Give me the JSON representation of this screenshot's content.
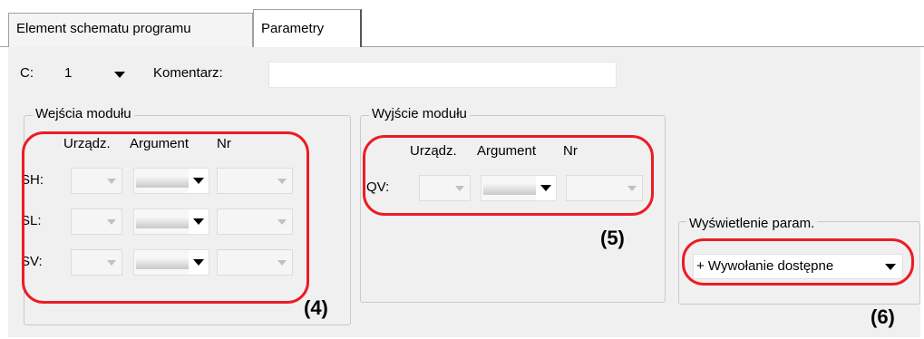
{
  "tabs": [
    {
      "label": "Element schematu programu",
      "active": false
    },
    {
      "label": "Parametry",
      "active": true
    }
  ],
  "top": {
    "c_label": "C:",
    "c_value": "1",
    "comment_label": "Komentarz:",
    "comment_value": ""
  },
  "inputs_group": {
    "title": "Wejścia modułu",
    "col_device": "Urządz.",
    "col_argument": "Argument",
    "col_nr": "Nr",
    "rows": [
      {
        "label": "SH:"
      },
      {
        "label": "SL:"
      },
      {
        "label": "SV:"
      }
    ]
  },
  "output_group": {
    "title": "Wyjście modułu",
    "col_device": "Urządz.",
    "col_argument": "Argument",
    "col_nr": "Nr",
    "rows": [
      {
        "label": "QV:"
      }
    ]
  },
  "display_group": {
    "title": "Wyświetlenie param.",
    "select_value": "+ Wywołanie dostępne"
  },
  "annotations": [
    "(4)",
    "(5)",
    "(6)"
  ],
  "colors": {
    "annotation": "#ec1c24",
    "panel": "#f0f0f0"
  }
}
